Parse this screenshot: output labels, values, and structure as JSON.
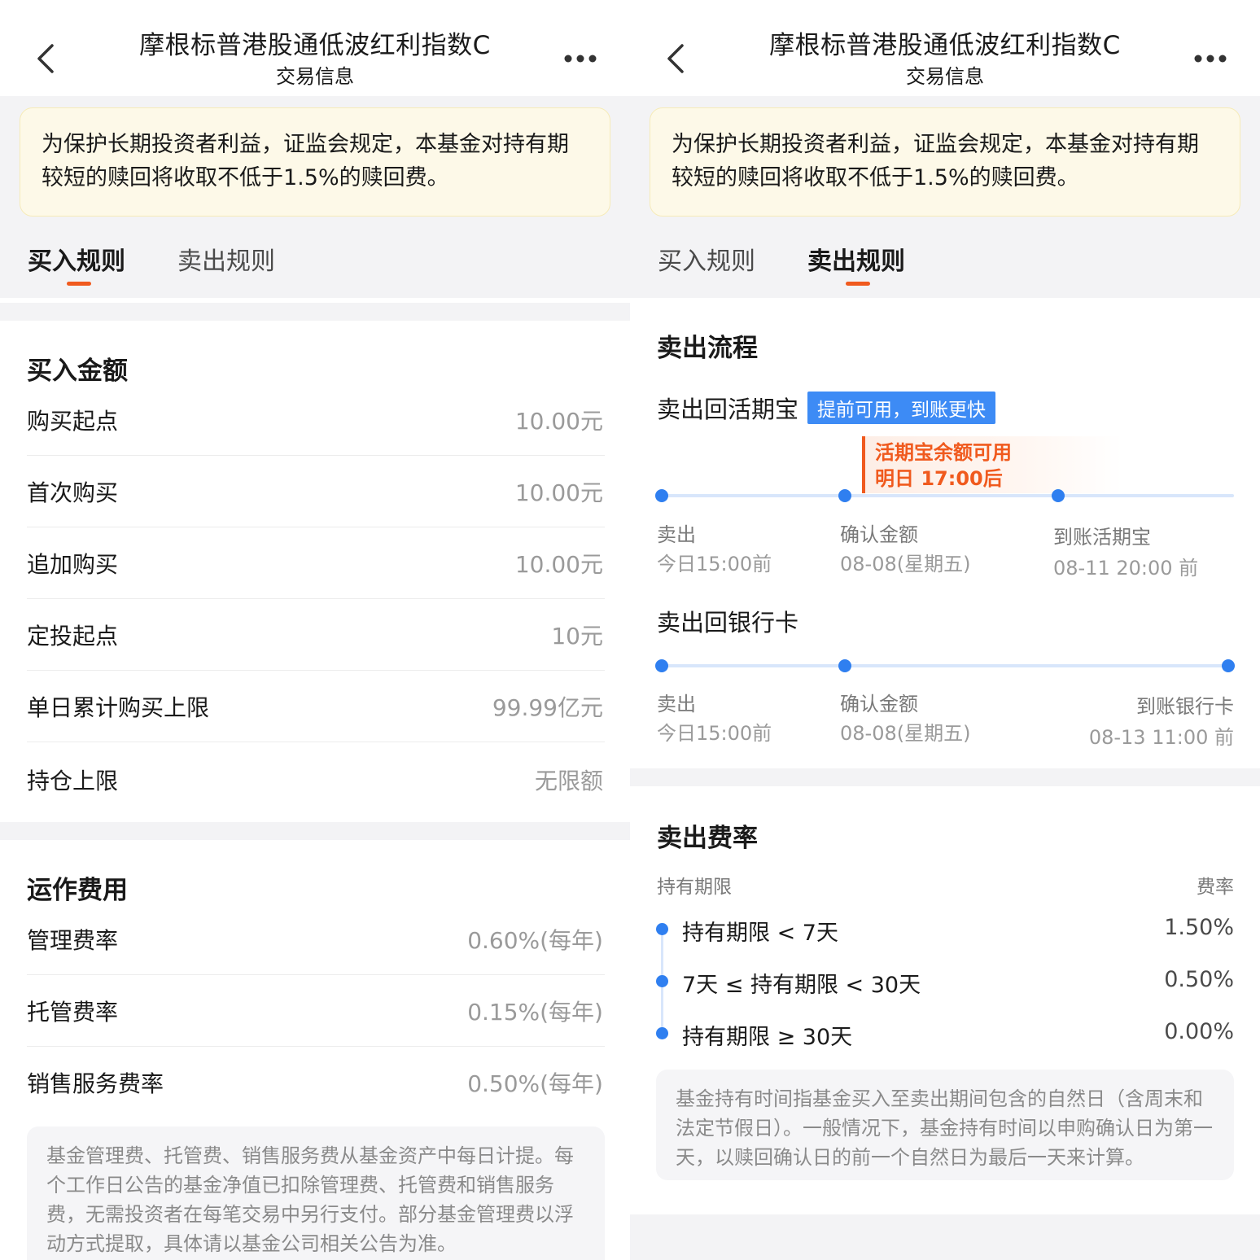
{
  "header": {
    "title": "摩根标普港股通低波红利指数C",
    "subtitle": "交易信息"
  },
  "notice": "为保护长期投资者利益，证监会规定，本基金对持有期较短的赎回将收取不低于1.5%的赎回费。",
  "tabs": [
    {
      "label": "买入规则"
    },
    {
      "label": "卖出规则"
    }
  ],
  "buy": {
    "amount_title": "买入金额",
    "rows": [
      {
        "label": "购买起点",
        "value": "10.00元"
      },
      {
        "label": "首次购买",
        "value": "10.00元"
      },
      {
        "label": "追加购买",
        "value": "10.00元"
      },
      {
        "label": "定投起点",
        "value": "10元"
      },
      {
        "label": "单日累计购买上限",
        "value": "99.99亿元"
      },
      {
        "label": "持仓上限",
        "value": "无限额"
      }
    ],
    "fee_title": "运作费用",
    "fees": [
      {
        "label": "管理费率",
        "value": "0.60%(每年)"
      },
      {
        "label": "托管费率",
        "value": "0.15%(每年)"
      },
      {
        "label": "销售服务费率",
        "value": "0.50%(每年)"
      }
    ],
    "fee_note": "基金管理费、托管费、销售服务费从基金资产中每日计提。每个工作日公告的基金净值已扣除管理费、托管费和销售服务费，无需投资者在每笔交易中另行支付。部分基金管理费以浮动方式提取，具体请以基金公司相关公告为准。"
  },
  "sell": {
    "process_title": "卖出流程",
    "to_huoqibao": {
      "title": "卖出回活期宝",
      "tag": "提前可用，到账更快",
      "highlight_line1": "活期宝余额可用",
      "highlight_line2": "明日 17:00后",
      "steps": [
        {
          "label": "卖出",
          "date": "今日15:00前"
        },
        {
          "label": "确认金额",
          "date": "08-08(星期五)"
        },
        {
          "label": "到账活期宝",
          "date": "08-11 20:00 前"
        }
      ]
    },
    "to_bank": {
      "title": "卖出回银行卡",
      "steps": [
        {
          "label": "卖出",
          "date": "今日15:00前"
        },
        {
          "label": "确认金额",
          "date": "08-08(星期五)"
        },
        {
          "label": "到账银行卡",
          "date": "08-13 11:00 前"
        }
      ]
    },
    "fee_title": "卖出费率",
    "fee_header": {
      "left": "持有期限",
      "right": "费率"
    },
    "fee_rows": [
      {
        "label": "持有期限 < 7天",
        "value": "1.50%"
      },
      {
        "label": "7天 ≤ 持有期限 < 30天",
        "value": "0.50%"
      },
      {
        "label": "持有期限 ≥ 30天",
        "value": "0.00%"
      }
    ],
    "fee_note": "基金持有时间指基金买入至卖出期间包含的自然日（含周末和法定节假日）。一般情况下，基金持有时间以申购确认日为第一天，以赎回确认日的前一个自然日为最后一天来计算。"
  },
  "icons": {
    "back": "chevron-left-icon",
    "more": "more-dots-icon"
  },
  "colors": {
    "accent": "#f05a1e",
    "timeline_blue": "#2f7ff0",
    "notice_bg": "#fdf9e8"
  }
}
